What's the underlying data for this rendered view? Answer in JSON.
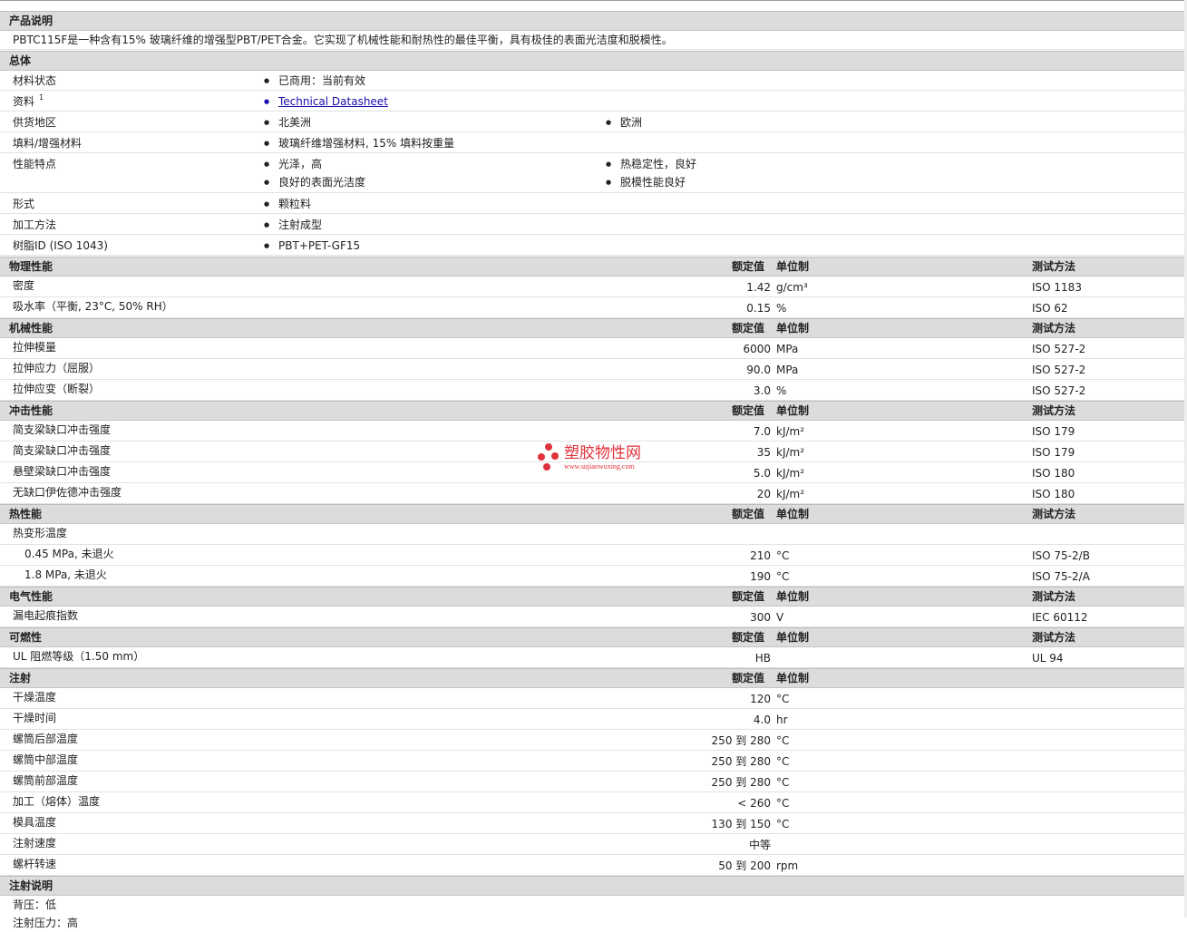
{
  "intro": {
    "heading": "产品说明",
    "text": "PBTC115F是一种含有15% 玻璃纤维的增强型PBT/PET合金。它实现了机械性能和耐热性的最佳平衡，具有极佳的表面光洁度和脱模性。"
  },
  "general": {
    "heading": "总体",
    "rows": [
      {
        "label": "材料状态",
        "col1": [
          "已商用：当前有效"
        ],
        "col2": []
      },
      {
        "label": "资料",
        "sup": "1",
        "col1": [
          "Technical Datasheet"
        ],
        "col2": [],
        "link": true
      },
      {
        "label": "供货地区",
        "col1": [
          "北美洲"
        ],
        "col2": [
          "欧洲"
        ]
      },
      {
        "label": "填料/增强材料",
        "col1": [
          "玻璃纤维增强材料, 15% 填料按重量"
        ],
        "col2": []
      },
      {
        "label": "性能特点",
        "col1": [
          "光泽，高",
          "良好的表面光洁度"
        ],
        "col2": [
          "热稳定性，良好",
          "脱模性能良好"
        ]
      },
      {
        "label": "形式",
        "col1": [
          "颗粒料"
        ],
        "col2": []
      },
      {
        "label": "加工方法",
        "col1": [
          "注射成型"
        ],
        "col2": []
      },
      {
        "label": "树脂ID (ISO 1043)",
        "col1": [
          "PBT+PET-GF15"
        ],
        "col2": []
      }
    ]
  },
  "column_headers": {
    "value": "额定值",
    "unit": "单位制",
    "method": "测试方法"
  },
  "sections": [
    {
      "title": "物理性能",
      "method": true,
      "rows": [
        {
          "label": "密度",
          "value": "1.42",
          "unit": "g/cm³",
          "method": "ISO 1183"
        },
        {
          "label": "吸水率（平衡, 23°C, 50% RH）",
          "value": "0.15",
          "unit": "%",
          "method": "ISO 62"
        }
      ]
    },
    {
      "title": "机械性能",
      "method": true,
      "rows": [
        {
          "label": "拉伸模量",
          "value": "6000",
          "unit": "MPa",
          "method": "ISO 527-2"
        },
        {
          "label": "拉伸应力（屈服）",
          "value": "90.0",
          "unit": "MPa",
          "method": "ISO 527-2"
        },
        {
          "label": "拉伸应变（断裂）",
          "value": "3.0",
          "unit": "%",
          "method": "ISO 527-2"
        }
      ]
    },
    {
      "title": "冲击性能",
      "method": true,
      "rows": [
        {
          "label": "简支梁缺口冲击强度",
          "value": "7.0",
          "unit": "kJ/m²",
          "method": "ISO 179"
        },
        {
          "label": "简支梁缺口冲击强度",
          "value": "35",
          "unit": "kJ/m²",
          "method": "ISO 179"
        },
        {
          "label": "悬壁梁缺口冲击强度",
          "value": "5.0",
          "unit": "kJ/m²",
          "method": "ISO 180"
        },
        {
          "label": "无缺口伊佐德冲击强度",
          "value": "20",
          "unit": "kJ/m²",
          "method": "ISO 180"
        }
      ]
    },
    {
      "title": "热性能",
      "method": true,
      "rows": [
        {
          "label": "热变形温度",
          "value": "",
          "unit": "",
          "method": ""
        },
        {
          "label": "0.45 MPa, 未退火",
          "indent": true,
          "value": "210",
          "unit": "°C",
          "method": "ISO 75-2/B"
        },
        {
          "label": "1.8 MPa, 未退火",
          "indent": true,
          "value": "190",
          "unit": "°C",
          "method": "ISO 75-2/A"
        }
      ]
    },
    {
      "title": "电气性能",
      "method": true,
      "rows": [
        {
          "label": "漏电起痕指数",
          "value": "300",
          "unit": "V",
          "method": "IEC 60112"
        }
      ]
    },
    {
      "title": "可燃性",
      "method": true,
      "rows": [
        {
          "label": "UL 阻燃等级（1.50 mm）",
          "value": "HB",
          "unit": "",
          "method": "UL 94"
        }
      ]
    },
    {
      "title": "注射",
      "method": false,
      "rows": [
        {
          "label": "干燥温度",
          "value": "120",
          "unit": "°C",
          "method": ""
        },
        {
          "label": "干燥时间",
          "value": "4.0",
          "unit": "hr",
          "method": ""
        },
        {
          "label": "螺筒后部温度",
          "value": "250 到  280",
          "unit": "°C",
          "method": ""
        },
        {
          "label": "螺筒中部温度",
          "value": "250 到  280",
          "unit": "°C",
          "method": ""
        },
        {
          "label": "螺筒前部温度",
          "value": "250 到  280",
          "unit": "°C",
          "method": ""
        },
        {
          "label": "加工（熔体）温度",
          "value": "< 260",
          "unit": "°C",
          "method": ""
        },
        {
          "label": "模具温度",
          "value": "130 到  150",
          "unit": "°C",
          "method": ""
        },
        {
          "label": "注射速度",
          "value": "中等",
          "unit": "",
          "method": ""
        },
        {
          "label": "螺杆转速",
          "value": "50 到  200",
          "unit": "rpm",
          "method": ""
        }
      ]
    }
  ],
  "notes": {
    "heading": "注射说明",
    "lines": [
      "背压：低",
      "注射压力：高"
    ]
  },
  "watermark": {
    "text": "塑胶物性网",
    "url": "www.sujiaowuxing.com",
    "color": "#e0323c"
  }
}
